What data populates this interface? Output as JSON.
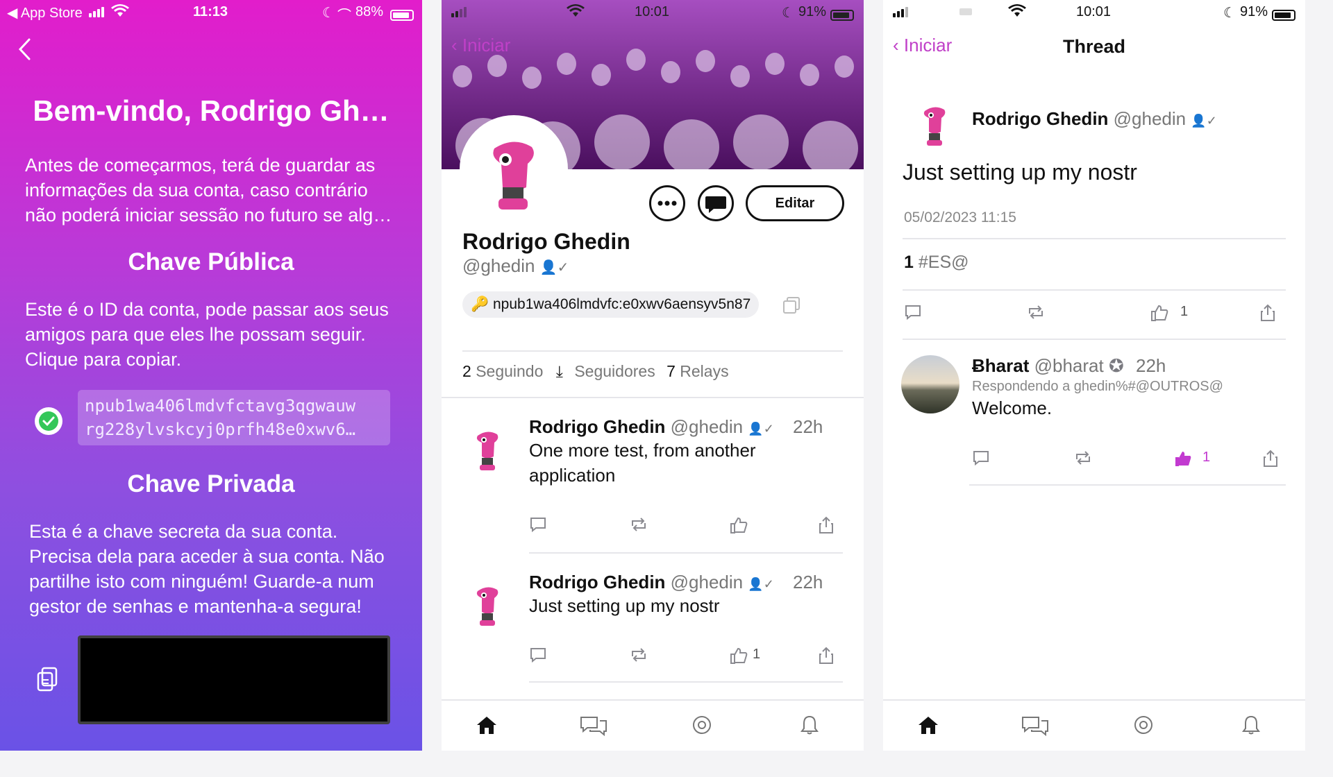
{
  "colors": {
    "accent": "#c040c8",
    "like_active": "#c23ad0",
    "verified": "#7a7a80"
  },
  "screen1": {
    "status": {
      "back_app": "◀ App Store",
      "time": "11:13",
      "battery": "88%"
    },
    "title": "Bem-vindo, Rodrigo Gh…",
    "intro": "Antes de começarmos, terá de guardar as informações da sua conta, caso contrário não poderá iniciar sessão no futuro se alg…",
    "public_key": {
      "heading": "Chave Pública",
      "description": "Este é o ID da conta, pode passar aos seus amigos para que eles lhe possam seguir. Clique para copiar.",
      "value": "npub1wa406lmdvfctavg3qgwauw rg228ylvskcyj0prfh48e0xwv6…"
    },
    "private_key": {
      "heading": "Chave Privada",
      "description": "Esta é a chave secreta da sua conta. Precisa dela para aceder à sua conta. Não partilhe isto com ninguém! Guarde-a num gestor de senhas e mantenha-a segura!"
    }
  },
  "screen2": {
    "status": {
      "time": "10:01",
      "battery": "91%"
    },
    "back_label": "Iniciar",
    "edit_label": "Editar",
    "profile": {
      "name": "Rodrigo Ghedin",
      "handle": "@ghedin",
      "npub": "npub1wa406lmdvfc:e0xwv6aensyv5n87"
    },
    "stats": {
      "following_count": "2",
      "following_label": "Seguindo",
      "followers_label": "Seguidores",
      "relays_count": "7",
      "relays_label": "Relays"
    },
    "posts": [
      {
        "name": "Rodrigo Ghedin",
        "handle": "@ghedin",
        "time": "22h",
        "text": "One more test, from another application",
        "likes": ""
      },
      {
        "name": "Rodrigo Ghedin",
        "handle": "@ghedin",
        "time": "22h",
        "text": "Just setting up my nostr",
        "likes": "1"
      }
    ]
  },
  "screen3": {
    "status": {
      "time": "10:01",
      "battery": "91%"
    },
    "back_label": "Iniciar",
    "title": "Thread",
    "main_post": {
      "name": "Rodrigo Ghedin",
      "handle": "@ghedin",
      "text": "Just setting up my nostr",
      "date": "05/02/2023 11:15",
      "reactions_count": "1",
      "reactions_label": "#ES@",
      "likes": "1"
    },
    "reply": {
      "name": "Ƀharat",
      "handle": "@bharat",
      "time": "22h",
      "replying_to": "Respondendo a ghedin%#@OUTROS@",
      "text": "Welcome.",
      "likes": "1"
    }
  }
}
